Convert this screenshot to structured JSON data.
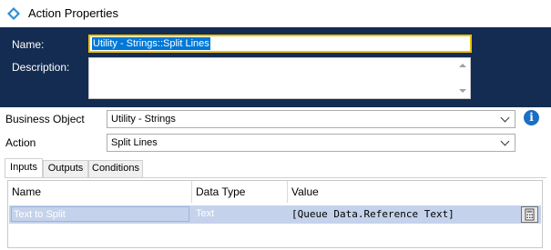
{
  "window": {
    "title": "Action Properties",
    "icon": "blueprism-diamond-icon"
  },
  "header": {
    "name_label": "Name:",
    "name_value": "Utility - Strings::Split Lines",
    "description_label": "Description:",
    "description_value": ""
  },
  "fields": {
    "business_object_label": "Business Object",
    "business_object_value": "Utility - Strings",
    "action_label": "Action",
    "action_value": "Split Lines"
  },
  "tabs": [
    {
      "label": "Inputs",
      "active": true
    },
    {
      "label": "Outputs",
      "active": false
    },
    {
      "label": "Conditions",
      "active": false
    }
  ],
  "grid": {
    "columns": [
      "Name",
      "Data Type",
      "Value"
    ],
    "rows": [
      {
        "name": "Text to Split",
        "data_type": "Text",
        "value": "[Queue Data.Reference Text]"
      }
    ]
  },
  "colors": {
    "header_bg": "#142c52",
    "selection": "#0078d7",
    "row_selected": "#c5d2eb",
    "focus_border": "#f0c000"
  }
}
